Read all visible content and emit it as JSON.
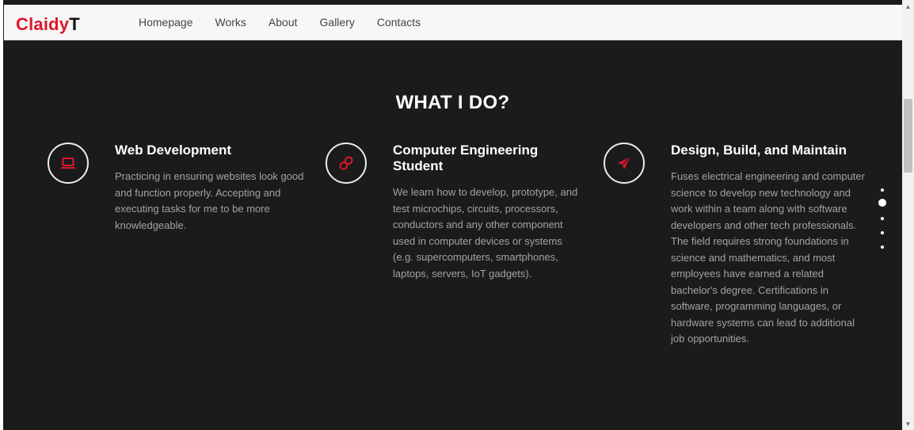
{
  "header": {
    "logo_part1": "Claidy",
    "logo_part2": "T",
    "nav": [
      "Homepage",
      "Works",
      "About",
      "Gallery",
      "Contacts"
    ]
  },
  "section": {
    "title": "WHAT I DO?"
  },
  "services": [
    {
      "icon": "laptop-icon",
      "title": "Web Development",
      "description": "Practicing in ensuring websites look good and function properly. Accepting and executing tasks for me to be more knowledgeable."
    },
    {
      "icon": "link-icon",
      "title": "Computer Engineering Student",
      "description": "We learn how to develop, prototype, and test microchips, circuits, processors, conductors and any other component used in computer devices or systems (e.g. supercomputers, smartphones, laptops, servers, IoT gadgets)."
    },
    {
      "icon": "paper-plane-icon",
      "title": "Design, Build, and Maintain",
      "description": "Fuses electrical engineering and computer science to develop new technology and work within a team along with software developers and other tech professionals. The field requires strong foundations in science and mathematics, and most employees have earned a related bachelor's degree. Certifications in software, programming languages, or hardware systems can lead to additional job opportunities."
    }
  ],
  "page_dots": {
    "count": 5,
    "active_index": 1
  },
  "colors": {
    "accent": "#e0162b",
    "background": "#1b1b1c",
    "navbar": "#f7f7f7",
    "text_muted": "#a3a3a3"
  }
}
